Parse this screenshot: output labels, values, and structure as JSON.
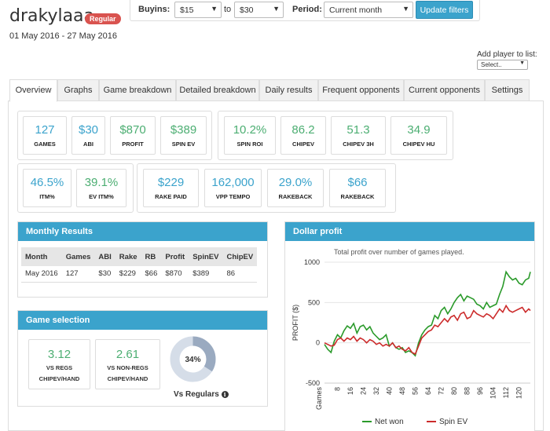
{
  "header": {
    "username": "drakylaaa",
    "badge": "Regular",
    "date_range": "01 May 2016 - 27 May 2016"
  },
  "filters": {
    "buyins_label": "Buyins:",
    "buyin_from": "$15",
    "to_label": "to",
    "buyin_to": "$30",
    "period_label": "Period:",
    "period": "Current month",
    "update_label": "Update filters"
  },
  "add_player": {
    "label": "Add player to list:",
    "select_value": "Select.."
  },
  "tabs": [
    {
      "label": "Overview"
    },
    {
      "label": "Graphs"
    },
    {
      "label": "Game breakdown"
    },
    {
      "label": "Detailed breakdown"
    },
    {
      "label": "Daily results"
    },
    {
      "label": "Frequent opponents"
    },
    {
      "label": "Current opponents"
    },
    {
      "label": "Settings"
    }
  ],
  "stats": [
    {
      "value": "127",
      "label": "GAMES",
      "color": "#3ba3cc"
    },
    {
      "value": "$30",
      "label": "ABI",
      "color": "#3ba3cc"
    },
    {
      "value": "$870",
      "label": "PROFIT",
      "color": "#4cae72"
    },
    {
      "value": "$389",
      "label": "SPIN EV",
      "color": "#4cae72"
    },
    {
      "value": "10.2%",
      "label": "SPIN ROI",
      "color": "#4cae72"
    },
    {
      "value": "86.2",
      "label": "CHIPEV",
      "color": "#4cae72"
    },
    {
      "value": "51.3",
      "label": "CHIPEV 3H",
      "color": "#4cae72"
    },
    {
      "value": "34.9",
      "label": "CHIPEV HU",
      "color": "#4cae72"
    },
    {
      "value": "46.5%",
      "label": "ITM%",
      "color": "#3ba3cc"
    },
    {
      "value": "39.1%",
      "label": "EV ITM%",
      "color": "#4cae72"
    },
    {
      "value": "$229",
      "label": "RAKE PAID",
      "color": "#3ba3cc"
    },
    {
      "value": "162,000",
      "label": "VPP TEMPO",
      "color": "#3ba3cc"
    },
    {
      "value": "29.0%",
      "label": "RAKEBACK",
      "color": "#3ba3cc"
    },
    {
      "value": "$66",
      "label": "RAKEBACK",
      "color": "#3ba3cc"
    }
  ],
  "monthly": {
    "title": "Monthly Results",
    "columns": [
      "Month",
      "Games",
      "ABI",
      "Rake",
      "RB",
      "Profit",
      "SpinEV",
      "ChipEV"
    ],
    "rows": [
      [
        "May 2016",
        "127",
        "$30",
        "$229",
        "$66",
        "$870",
        "$389",
        "86"
      ]
    ]
  },
  "game_selection": {
    "title": "Game selection",
    "vs_regs": {
      "value": "3.12",
      "line1": "VS REGS",
      "line2": "CHIPEV/HAND"
    },
    "vs_nonregs": {
      "value": "2.61",
      "line1": "VS NON-REGS",
      "line2": "CHIPEV/HAND"
    },
    "donut_value": 0.34,
    "donut_label": "34%",
    "vs_regulars_label": "Vs Regulars",
    "info_icon": "info-circle-icon"
  },
  "dollar_profit": {
    "title": "Dollar profit",
    "subtitle": "Total profit over number of games played."
  },
  "chart_data": {
    "type": "line",
    "title": "",
    "ylabel": "PROFIT ($)",
    "xlabel": "Games",
    "ylim": [
      -500,
      1000
    ],
    "xlim": [
      0,
      127
    ],
    "yticks": [
      -500,
      0,
      500,
      1000
    ],
    "xticks": [
      8,
      16,
      24,
      32,
      40,
      48,
      56,
      64,
      72,
      80,
      88,
      96,
      104,
      112,
      120
    ],
    "legend_position": "bottom",
    "series": [
      {
        "name": "Net won",
        "color": "#2a9a2a",
        "x": [
          0,
          2,
          4,
          6,
          8,
          10,
          12,
          14,
          16,
          18,
          20,
          22,
          24,
          26,
          28,
          30,
          32,
          34,
          36,
          38,
          40,
          42,
          44,
          46,
          48,
          50,
          52,
          54,
          56,
          58,
          60,
          62,
          64,
          66,
          68,
          70,
          72,
          74,
          76,
          78,
          80,
          82,
          84,
          86,
          88,
          90,
          92,
          94,
          96,
          98,
          100,
          102,
          104,
          106,
          108,
          110,
          112,
          114,
          116,
          118,
          120,
          122,
          124,
          126,
          127
        ],
        "y": [
          -20,
          -80,
          -120,
          20,
          100,
          60,
          150,
          210,
          180,
          240,
          120,
          200,
          220,
          160,
          200,
          120,
          80,
          40,
          60,
          100,
          -40,
          0,
          -60,
          -80,
          -60,
          -120,
          -100,
          -120,
          -160,
          0,
          100,
          160,
          200,
          220,
          340,
          300,
          400,
          440,
          360,
          420,
          500,
          560,
          600,
          520,
          580,
          560,
          540,
          480,
          460,
          420,
          500,
          440,
          460,
          480,
          600,
          700,
          880,
          820,
          780,
          800,
          740,
          720,
          780,
          800,
          880
        ]
      },
      {
        "name": "Spin EV",
        "color": "#cc2b2b",
        "x": [
          0,
          2,
          4,
          6,
          8,
          10,
          12,
          14,
          16,
          18,
          20,
          22,
          24,
          26,
          28,
          30,
          32,
          34,
          36,
          38,
          40,
          42,
          44,
          46,
          48,
          50,
          52,
          54,
          56,
          58,
          60,
          62,
          64,
          66,
          68,
          70,
          72,
          74,
          76,
          78,
          80,
          82,
          84,
          86,
          88,
          90,
          92,
          94,
          96,
          98,
          100,
          102,
          104,
          106,
          108,
          110,
          112,
          114,
          116,
          118,
          120,
          122,
          124,
          126,
          127
        ],
        "y": [
          0,
          -20,
          -40,
          -30,
          40,
          60,
          20,
          60,
          40,
          80,
          20,
          60,
          40,
          0,
          40,
          20,
          -20,
          0,
          -40,
          -20,
          -40,
          0,
          -60,
          -40,
          -80,
          -100,
          -60,
          -120,
          -140,
          -40,
          60,
          100,
          140,
          160,
          220,
          200,
          250,
          300,
          260,
          320,
          340,
          280,
          360,
          380,
          300,
          320,
          400,
          360,
          340,
          320,
          360,
          340,
          300,
          360,
          420,
          380,
          460,
          400,
          380,
          400,
          420,
          440,
          380,
          420,
          400
        ]
      }
    ]
  }
}
